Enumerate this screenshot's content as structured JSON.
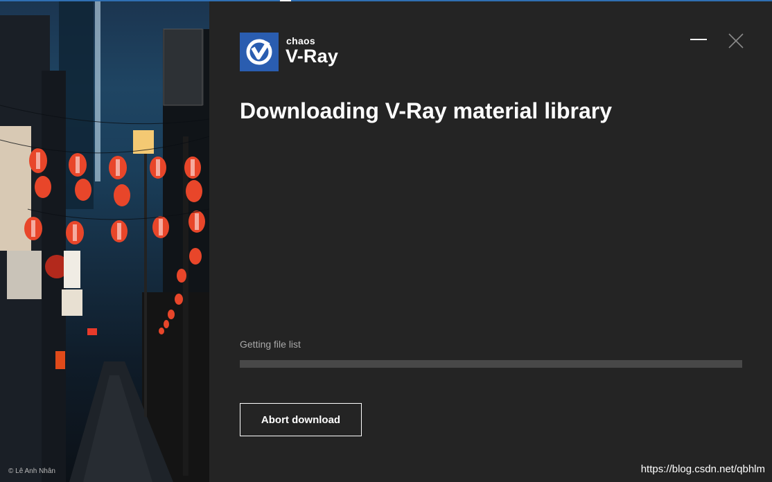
{
  "window": {
    "brand_small": "chaos",
    "brand_large": "V-Ray",
    "title": "Downloading V-Ray material library",
    "status_text": "Getting file list",
    "progress_percent": 0,
    "abort_label": "Abort download",
    "minimize_icon": "minimize-icon",
    "close_icon": "close-icon"
  },
  "side_image": {
    "credit": "© Lê Anh Nhân"
  },
  "watermark": "https://blog.csdn.net/qbhlm",
  "colors": {
    "background": "#242424",
    "accent": "#2a5db0",
    "progress_track": "#484848",
    "text_primary": "#ffffff",
    "text_secondary": "#a9a9a9"
  }
}
